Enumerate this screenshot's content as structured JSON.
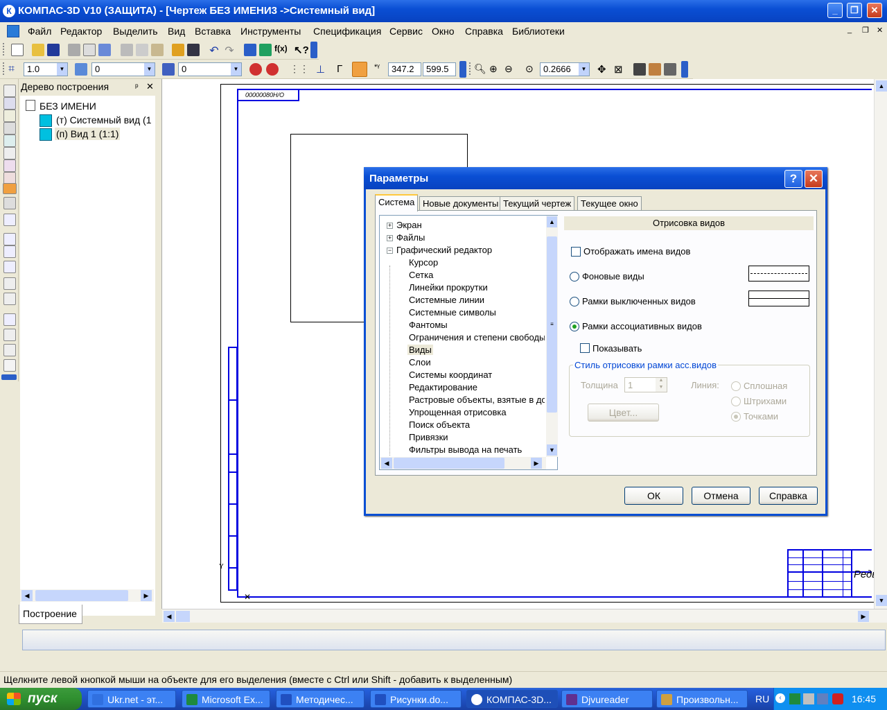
{
  "titlebar": {
    "title": "КОМПАС-3D V10 (ЗАЩИТА) - [Чертеж БЕЗ ИМЕНИ3 ->Системный вид]",
    "app_icon": "К"
  },
  "menu": [
    "Файл",
    "Редактор",
    "Выделить",
    "Вид",
    "Вставка",
    "Инструменты",
    "Спецификация",
    "Сервис",
    "Окно",
    "Справка",
    "Библиотеки"
  ],
  "toolbar3": {
    "scale": "1.0",
    "layer": "0",
    "style": "0",
    "x": "347.2",
    "y": "599.5",
    "zoom": "0.2666"
  },
  "tree": {
    "title": "Дерево построения",
    "root": "БЕЗ ИМЕНИ",
    "items": [
      "(т) Системный вид (1",
      "(п) Вид 1 (1:1)"
    ],
    "tab": "Построение"
  },
  "drawing": {
    "stamp": "00000080Н/О",
    "title_block_text": "Редь"
  },
  "dialog": {
    "title": "Параметры",
    "tabs": [
      "Система",
      "Новые документы",
      "Текущий чертеж",
      "Текущее окно"
    ],
    "tree": {
      "top": [
        "Экран",
        "Файлы",
        "Графический редактор"
      ],
      "children": [
        "Курсор",
        "Сетка",
        "Линейки прокрутки",
        "Системные линии",
        "Системные символы",
        "Фантомы",
        "Ограничения и степени свободы",
        "Виды",
        "Слои",
        "Системы координат",
        "Редактирование",
        "Растровые объекты, взятые в до",
        "Упрощенная отрисовка",
        "Поиск объекта",
        "Привязки",
        "Фильтры вывода на печать"
      ],
      "selected": "Виды"
    },
    "section_header": "Отрисовка видов",
    "show_names": "Отображать имена видов",
    "opt_background": "Фоновые виды",
    "opt_disabled_frames": "Рамки выключенных видов",
    "opt_assoc_frames": "Рамки ассоциативных видов",
    "show_checkbox": "Показывать",
    "group_title": "Стиль отрисовки рамки асс.видов",
    "thickness_label": "Толщина",
    "thickness_value": "1",
    "line_label": "Линия:",
    "line_options": [
      "Сплошная",
      "Штрихами",
      "Точками"
    ],
    "color_button": "Цвет...",
    "ok": "ОК",
    "cancel": "Отмена",
    "help": "Справка",
    "help_icon": "?"
  },
  "status_hint": "Щелкните левой кнопкой мыши на объекте для его выделения (вместе с Ctrl или Shift - добавить к выделенным)",
  "taskbar": {
    "start": "пуск",
    "tasks": [
      "Ukr.net - эт...",
      "Microsoft Ex...",
      "Методичес...",
      "Рисунки.do...",
      "КОМПАС-3D...",
      "Djvureader",
      "Произвольн..."
    ],
    "lang": "RU",
    "clock": "16:45"
  }
}
